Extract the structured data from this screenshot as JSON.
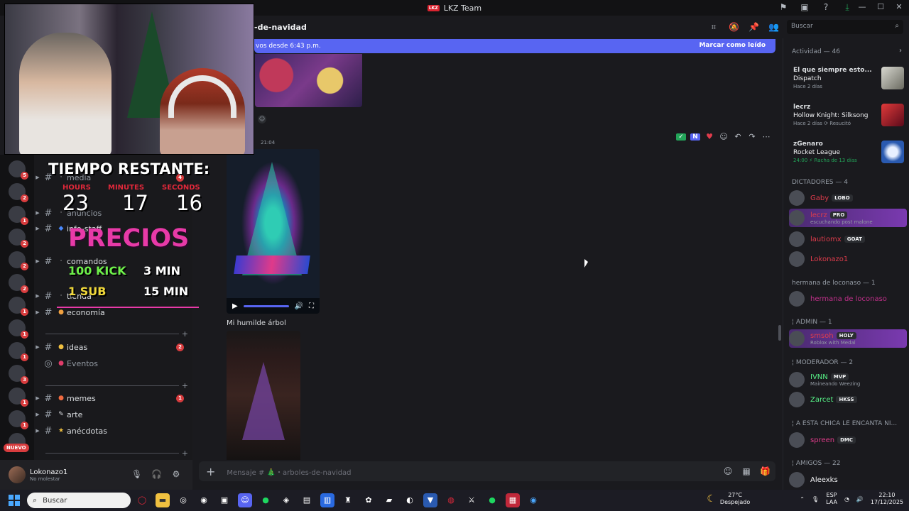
{
  "window": {
    "title": "LKZ Team",
    "badge": "LKZ"
  },
  "header": {
    "channel_name": "-de-navidad"
  },
  "new_banner": {
    "text": "vos desde 6:43 p.m.",
    "action": "Marcar como leído"
  },
  "search": {
    "placeholder": "Buscar"
  },
  "servers": {
    "badges": [
      "5",
      "2",
      "1",
      "2",
      "2",
      "2",
      "1",
      "1",
      "1",
      "3",
      "1",
      "1",
      "2",
      "1"
    ],
    "new_label": "NUEVO"
  },
  "channels": [
    {
      "name": "media",
      "badge": "4",
      "dim": true
    },
    {
      "name": "anuncios",
      "badge": "",
      "dim": true
    },
    {
      "name": "info-staff",
      "badge": ""
    },
    {
      "name": "comandos",
      "badge": ""
    },
    {
      "name": "tienda",
      "badge": ""
    },
    {
      "name": "economía",
      "badge": ""
    },
    {
      "name": "ideas",
      "badge": "2"
    },
    {
      "name": "Eventos",
      "badge": "",
      "dim": true
    },
    {
      "name": "memes",
      "badge": "1"
    },
    {
      "name": "arte",
      "badge": ""
    },
    {
      "name": "anécdotas",
      "badge": ""
    }
  ],
  "user": {
    "name": "Lokonazo1",
    "status": "No molestar"
  },
  "messages": {
    "time": "21:04",
    "caption": "Mi humilde árbol"
  },
  "composer": {
    "placeholder": "Mensaje # 🎄・arboles-de-navidad"
  },
  "activity": {
    "title": "Actividad — 46",
    "items": [
      {
        "user": "El que siempre esto...",
        "user_color": "#57f287",
        "game": "Dispatch",
        "meta": "Hace 2 días"
      },
      {
        "user": "lecrz",
        "user_color": "#e03c4c",
        "game": "Hollow Knight: Silksong",
        "meta": "Hace 2 días  ⟳ Resucitó"
      },
      {
        "user": "zGenaro",
        "user_color": "#57f287",
        "game": "Rocket League",
        "meta": "24:00  ⚡ Racha de 13 días"
      }
    ]
  },
  "groups": [
    {
      "title": "DICTADORES — 4"
    },
    {
      "title": "hermana de loconaso — 1"
    },
    {
      "title": "¦ ADMIN — 1"
    },
    {
      "title": "¦ MODERADOR — 2"
    },
    {
      "title": "¦ A ESTA CHICA LE ENCANTA NI..."
    },
    {
      "title": "¦ AMIGOS — 22"
    }
  ],
  "members": [
    {
      "name": "Gaby",
      "color": "#e03c4c",
      "tag": "LOBO",
      "sub": ""
    },
    {
      "name": "lecrz",
      "color": "#e03c4c",
      "tag": "PRO",
      "sub": "escuchando post malone",
      "highlight": true
    },
    {
      "name": "lautiomx",
      "color": "#e03c4c",
      "tag": "GOAT",
      "sub": ""
    },
    {
      "name": "Lokonazo1",
      "color": "#e03c4c",
      "tag": "",
      "sub": ""
    },
    {
      "name": "hermana de loconaso",
      "color": "#c0308a",
      "tag": "",
      "sub": ""
    },
    {
      "name": "smsoh",
      "color": "#e03c4c",
      "tag": "HOLY",
      "sub": "Roblox with Medal",
      "highlight": true
    },
    {
      "name": "IVNN",
      "color": "#57f287",
      "tag": "MVP",
      "sub": "Maineando Weezing"
    },
    {
      "name": "Zarcet",
      "color": "#57f287",
      "tag": "HKSS",
      "sub": ""
    },
    {
      "name": "spreen",
      "color": "#e03c8a",
      "tag": "DMC",
      "sub": ""
    },
    {
      "name": "Aleexks",
      "color": "#f2f3f5",
      "tag": "",
      "sub": ""
    }
  ],
  "overlay": {
    "title": "TIEMPO RESTANTE:",
    "labels": [
      "HOURS",
      "MINUTES",
      "SECONDS"
    ],
    "values": [
      "23",
      "17",
      "16"
    ],
    "precios": "PRECIOS",
    "row1_left": "100 KICK",
    "row1_right": "3 MIN",
    "row2_left": "1 SUB",
    "row2_right": "15 MIN"
  },
  "taskbar": {
    "search": "Buscar",
    "weather_temp": "27°C",
    "weather_desc": "Despejado",
    "lang1": "ESP",
    "lang2": "LAA",
    "time": "22:10",
    "date": "17/12/2025"
  }
}
